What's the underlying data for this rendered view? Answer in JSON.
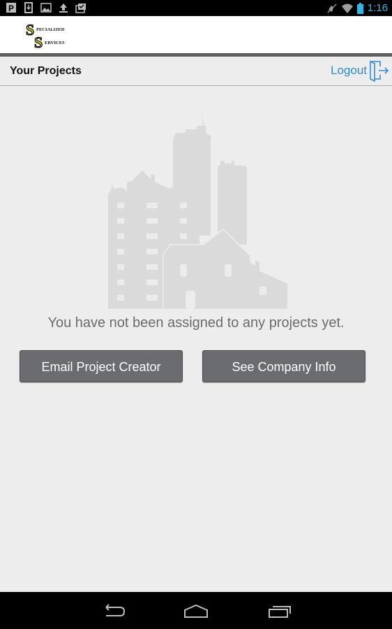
{
  "status_bar": {
    "notification_icons": [
      "parking-icon",
      "download-icon",
      "image-icon",
      "upload-icon",
      "briefcase-check-icon"
    ],
    "system_icons": [
      "no-sound-icon",
      "wifi-icon",
      "battery-icon"
    ],
    "time": "1:16"
  },
  "app_bar": {
    "logo": {
      "line1_initial": "S",
      "line1_rest": "PECIALIZED",
      "line2_initial": "S",
      "line2_rest": "ERVICES",
      "accent_color": "#d6d200"
    }
  },
  "header": {
    "title": "Your Projects",
    "logout_label": "Logout",
    "logout_icon": "logout-door-icon",
    "link_color": "#2f8bd8"
  },
  "main": {
    "illustration": "buildings-illustration",
    "empty_message": "You have not been assigned to any projects yet.",
    "buttons": {
      "email_creator": "Email Project Creator",
      "company_info": "See Company Info"
    }
  },
  "nav_bar": {
    "buttons": [
      "back-icon",
      "home-icon",
      "recents-icon"
    ]
  }
}
